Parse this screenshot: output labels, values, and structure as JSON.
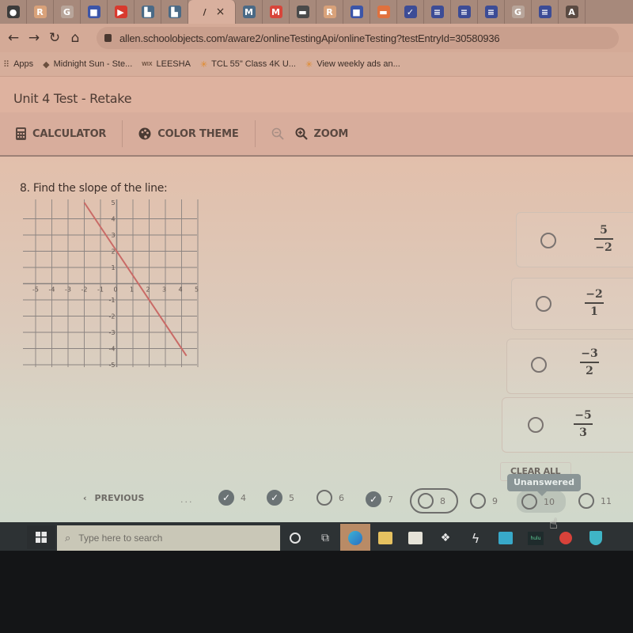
{
  "browser": {
    "tabs": [
      {
        "icon": "chrome-icon",
        "glyph": "●",
        "color": "#3b3b3b"
      },
      {
        "icon": "r-app-icon",
        "glyph": "R",
        "color": "#d9a27a"
      },
      {
        "icon": "google-icon",
        "glyph": "G",
        "color": "#b8a59a"
      },
      {
        "icon": "zoom-meeting-icon",
        "glyph": "■",
        "color": "#3c55a8"
      },
      {
        "icon": "youtube-icon",
        "glyph": "▶",
        "color": "#d83a2e"
      },
      {
        "icon": "classroom-icon",
        "glyph": "▙",
        "color": "#4a6a86"
      },
      {
        "icon": "classroom-icon",
        "glyph": "▙",
        "color": "#4a6a86"
      },
      {
        "icon": "active-tab-icon",
        "glyph": "/",
        "color": "#3a2b24",
        "active": true
      },
      {
        "icon": "gmail-icon",
        "glyph": "M",
        "color": "#4a6a86"
      },
      {
        "icon": "mcgraw-icon",
        "glyph": "M",
        "color": "#d8453a"
      },
      {
        "icon": "video-icon",
        "glyph": "▬",
        "color": "#4a4a4a"
      },
      {
        "icon": "r-app-icon",
        "glyph": "R",
        "color": "#d9a27a"
      },
      {
        "icon": "zoom-meeting-icon",
        "glyph": "■",
        "color": "#3c55a8"
      },
      {
        "icon": "slides-icon",
        "glyph": "▬",
        "color": "#e0713e"
      },
      {
        "icon": "forms-icon",
        "glyph": "✓",
        "color": "#3c4c96"
      },
      {
        "icon": "docs-icon",
        "glyph": "≡",
        "color": "#3c4c96"
      },
      {
        "icon": "docs-icon",
        "glyph": "≡",
        "color": "#3c4c96"
      },
      {
        "icon": "docs-icon",
        "glyph": "≡",
        "color": "#3c4c96"
      },
      {
        "icon": "google-icon",
        "glyph": "G",
        "color": "#b8a59a"
      },
      {
        "icon": "docs-icon",
        "glyph": "≡",
        "color": "#3c4c96"
      },
      {
        "icon": "a-app-icon",
        "glyph": "A",
        "color": "#5a4a42"
      }
    ],
    "url": "allen.schoolobjects.com/aware2/onlineTestingApi/onlineTesting?testEntryId=30580936",
    "bookmarks": [
      {
        "label": "Apps",
        "icon": "apps-grid-icon"
      },
      {
        "label": "Midnight Sun - Ste...",
        "icon": "book-icon"
      },
      {
        "label": "LEESHA",
        "icon": "wix-icon"
      },
      {
        "label": "TCL 55\" Class 4K U...",
        "icon": "walmart-icon"
      },
      {
        "label": "View weekly ads an...",
        "icon": "walmart-icon"
      }
    ]
  },
  "app": {
    "title": "Unit 4 Test - Retake",
    "toolbar": {
      "calculator": "CALCULATOR",
      "color_theme": "COLOR THEME",
      "zoom": "ZOOM"
    }
  },
  "question": {
    "number": 8,
    "text": "8. Find the slope of the line:",
    "graph": {
      "x_range": [
        -5,
        5
      ],
      "y_range": [
        -5,
        5
      ],
      "x_ticks": [
        "-5",
        "-4",
        "-3",
        "-2",
        "-1",
        "0",
        "1",
        "2",
        "3",
        "4",
        "5"
      ],
      "y_ticks": [
        "5",
        "4",
        "3",
        "2",
        "1",
        "-1",
        "-2",
        "-3",
        "-4",
        "-5"
      ],
      "line": {
        "from": [
          -2,
          5
        ],
        "to": [
          4,
          -4
        ],
        "color": "#c96a66"
      }
    },
    "choices": [
      {
        "numerator": "5",
        "denominator": "−2"
      },
      {
        "numerator": "−2",
        "denominator": "1"
      },
      {
        "numerator": "−3",
        "denominator": "2"
      },
      {
        "numerator": "−5",
        "denominator": "3"
      }
    ],
    "clear_all": "CLEAR ALL",
    "tooltip": "Unanswered"
  },
  "navigation": {
    "previous": "PREVIOUS",
    "ellipsis": "...",
    "questions": [
      {
        "num": "4",
        "status": "answered"
      },
      {
        "num": "5",
        "status": "answered"
      },
      {
        "num": "6",
        "status": "unanswered"
      },
      {
        "num": "7",
        "status": "answered"
      },
      {
        "num": "8",
        "status": "current"
      },
      {
        "num": "9",
        "status": "unanswered"
      },
      {
        "num": "10",
        "status": "hover"
      },
      {
        "num": "11",
        "status": "unanswered"
      }
    ]
  },
  "taskbar": {
    "search_placeholder": "Type here to search",
    "apps": [
      {
        "icon": "cortana-icon"
      },
      {
        "icon": "task-view-icon"
      },
      {
        "icon": "edge-icon",
        "active": true
      },
      {
        "icon": "file-explorer-icon"
      },
      {
        "icon": "store-icon"
      },
      {
        "icon": "dropbox-icon"
      },
      {
        "icon": "app-bolt-icon"
      },
      {
        "icon": "mail-icon"
      },
      {
        "icon": "hulu-icon",
        "label": "hulu"
      },
      {
        "icon": "red-app-icon"
      },
      {
        "icon": "defender-icon"
      }
    ]
  }
}
